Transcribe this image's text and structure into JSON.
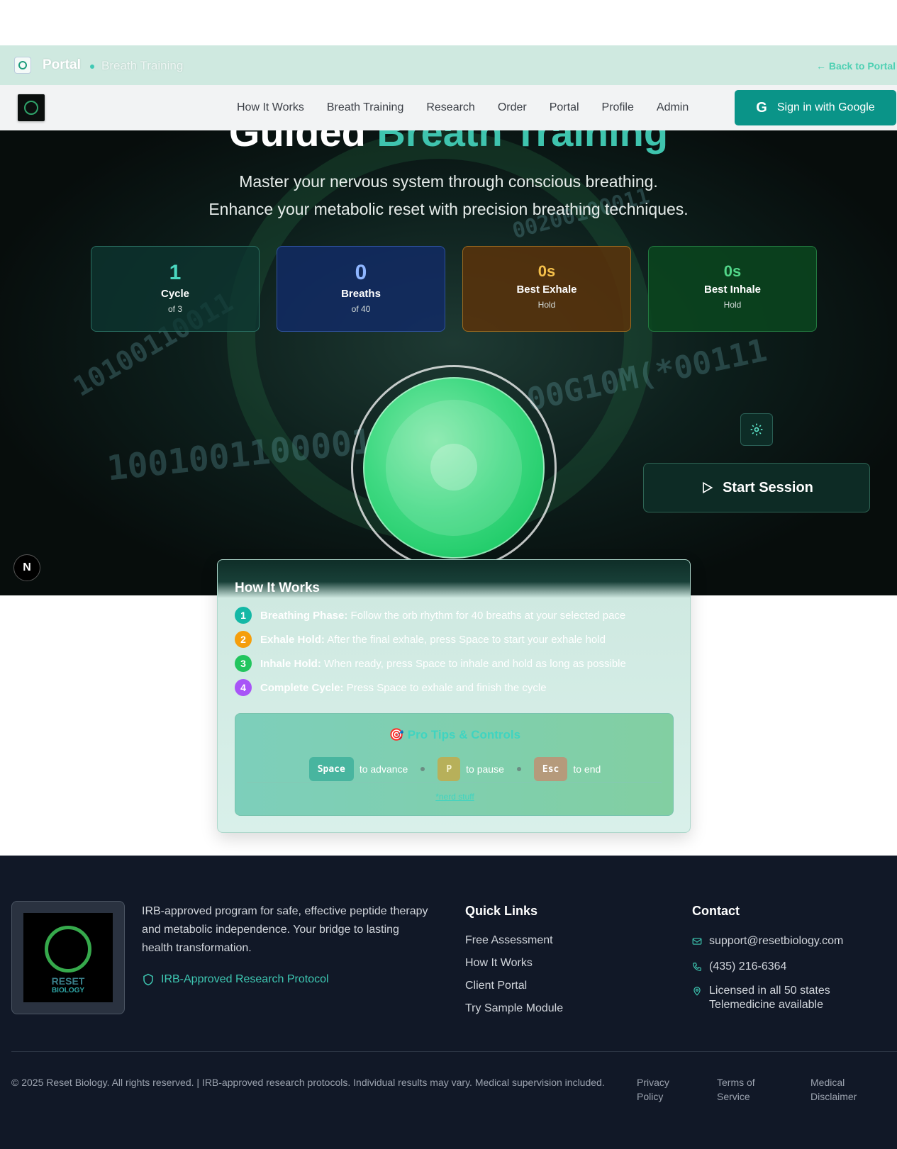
{
  "portal_bar": {
    "title": "Portal",
    "subtitle": "Breath Training",
    "back_link": "← Back to Portal"
  },
  "nav": {
    "links": [
      "How It Works",
      "Breath Training",
      "Research",
      "Order",
      "Portal",
      "Profile",
      "Admin"
    ],
    "sign_in": "Sign in with Google"
  },
  "hero": {
    "title_plain": "Guided",
    "title_accent": "Breath Training",
    "subtitle_line1": "Master your nervous system through conscious breathing.",
    "subtitle_line2": "Enhance your metabolic reset with precision breathing techniques.",
    "binary_1": "00200100011",
    "binary_2": "10100110011",
    "binary_3": "00G10M(*00111",
    "binary_4": "1001001100001",
    "stats": [
      {
        "value": "1",
        "label": "Cycle",
        "sub": "of 3"
      },
      {
        "value": "0",
        "label": "Breaths",
        "sub": "of 40"
      },
      {
        "value": "0s",
        "label": "Best Exhale",
        "sub": "Hold"
      },
      {
        "value": "0s",
        "label": "Best Inhale",
        "sub": "Hold"
      }
    ],
    "start_button": "Start Session",
    "next_badge": "N"
  },
  "how_it_works": {
    "title": "How It Works",
    "steps": [
      {
        "num": "1",
        "title": "Breathing Phase:",
        "text": "Follow the orb rhythm for 40 breaths at your selected pace",
        "color": "#14b8a6"
      },
      {
        "num": "2",
        "title": "Exhale Hold:",
        "text": "After the final exhale, press Space to start your exhale hold",
        "color": "#f59e0b"
      },
      {
        "num": "3",
        "title": "Inhale Hold:",
        "text": "When ready, press Space to inhale and hold as long as possible",
        "color": "#22c55e"
      },
      {
        "num": "4",
        "title": "Complete Cycle:",
        "text": "Press Space to exhale and finish the cycle",
        "color": "#a855f7"
      }
    ],
    "tips": {
      "title": "🎯 Pro Tips & Controls",
      "space_key": "Space",
      "space_text": "to advance",
      "p_key": "P",
      "p_text": "to pause",
      "esc_key": "Esc",
      "esc_text": "to end",
      "nerd_link": "*nerd stuff"
    }
  },
  "footer": {
    "logo_text_1": "RESET",
    "logo_text_2": "BIOLOGY",
    "description": "IRB-approved program for safe, effective peptide therapy and metabolic independence. Your bridge to lasting health transformation.",
    "irb_badge": "IRB-Approved Research Protocol",
    "quick_links_title": "Quick Links",
    "quick_links": [
      "Free Assessment",
      "How It Works",
      "Client Portal",
      "Try Sample Module"
    ],
    "contact_title": "Contact",
    "email": "support@resetbiology.com",
    "phone": "(435) 216-6364",
    "location_line1": "Licensed in all 50 states",
    "location_line2": "Telemedicine available",
    "copyright": "© 2025 Reset Biology. All rights reserved. | IRB-approved research protocols. Individual results may vary. Medical supervision included.",
    "legal": [
      "Privacy Policy",
      "Terms of Service",
      "Medical Disclaimer"
    ]
  }
}
